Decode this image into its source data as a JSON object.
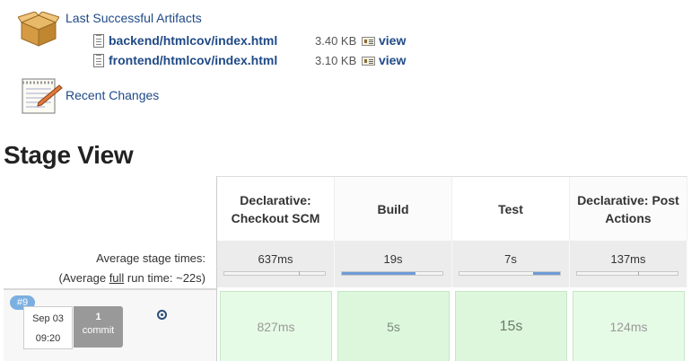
{
  "artifacts": {
    "title": "Last Successful Artifacts",
    "files": [
      {
        "name": "backend/htmlcov/index.html",
        "size": "3.40 KB",
        "view": "view"
      },
      {
        "name": "frontend/htmlcov/index.html",
        "size": "3.10 KB",
        "view": "view"
      }
    ]
  },
  "changes": {
    "title": "Recent Changes"
  },
  "stage_view": {
    "title": "Stage View",
    "avg_label": "Average stage times:",
    "avg_full_prefix": "(Average ",
    "avg_full_link": "full",
    "avg_full_suffix": " run time: ~22s)",
    "stages": [
      {
        "name": "Declarative: Checkout SCM",
        "avg": "637ms",
        "bar_fill": 0.0,
        "run_time": "827ms"
      },
      {
        "name": "Build",
        "avg": "19s",
        "bar_fill": 0.73,
        "run_time": "5s"
      },
      {
        "name": "Test",
        "avg": "7s",
        "bar_fill": 0.27,
        "run_time": "15s"
      },
      {
        "name": "Declarative: Post Actions",
        "avg": "137ms",
        "bar_fill": 0.0,
        "run_time": "124ms"
      }
    ],
    "run": {
      "badge": "#9",
      "date": "Sep 03",
      "time": "09:20",
      "commit_count": "1",
      "commit_label": "commit"
    }
  }
}
